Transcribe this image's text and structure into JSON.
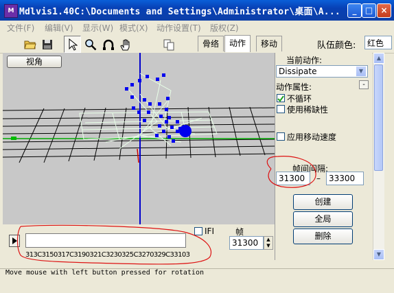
{
  "window": {
    "app_icon_text": "M",
    "title": "Mdlvis1.40C:\\Documents and Settings\\Administrator\\桌面\\A...",
    "minimize_label": "_",
    "maximize_label": "□",
    "close_label": "×"
  },
  "menu": [
    {
      "label": "文件(F)"
    },
    {
      "label": "编辑(V)"
    },
    {
      "label": "显示(W)"
    },
    {
      "label": "模式(X)"
    },
    {
      "label": "动作设置(T)"
    },
    {
      "label": "版权(Z)"
    }
  ],
  "toolbar": {
    "tools": [
      "open-folder-icon",
      "save-disk-icon",
      "arrow-cursor-icon",
      "magnifier-icon",
      "rotate-icon",
      "hand-icon",
      "copy-icon"
    ],
    "tabs": [
      {
        "label": "骨络",
        "active": false
      },
      {
        "label": "动作",
        "active": true
      },
      {
        "label": "移动",
        "active": false
      }
    ],
    "team_color_label": "队伍颜色:",
    "team_color_value": "红色"
  },
  "viewport": {
    "view_button": "视角",
    "grid_color": "#000000",
    "axis_vertical_color": "#0000cc",
    "axis_horizontal_color": "#00aa00",
    "vertex_color": "#0000ee"
  },
  "right_panel": {
    "current_action_label": "当前动作:",
    "current_action_value": "Dissipate",
    "action_props_label": "动作属性:",
    "no_loop_label": "不循环",
    "no_loop_checked": true,
    "use_rarity_label": "使用稀缺性",
    "use_rarity_checked": false,
    "move_speed_label": "应用移动速度",
    "move_speed_checked": false,
    "frame_interval_label": "帧间间隔:",
    "frame_start": "31300",
    "frame_dash": "–",
    "frame_end": "33300",
    "create_button": "创建",
    "global_button": "全局",
    "delete_button": "删除",
    "small_button": "-"
  },
  "timeline": {
    "ifi_label": "IFI",
    "frame_label": "帧",
    "frame_value": "31300",
    "ticks": "313C3150317C3190321C3230325C3270329C331033300",
    "play_icon": "play-icon"
  },
  "status": {
    "text": "Move mouse with left button pressed for rotation"
  },
  "annotation_color": "#dd1111"
}
